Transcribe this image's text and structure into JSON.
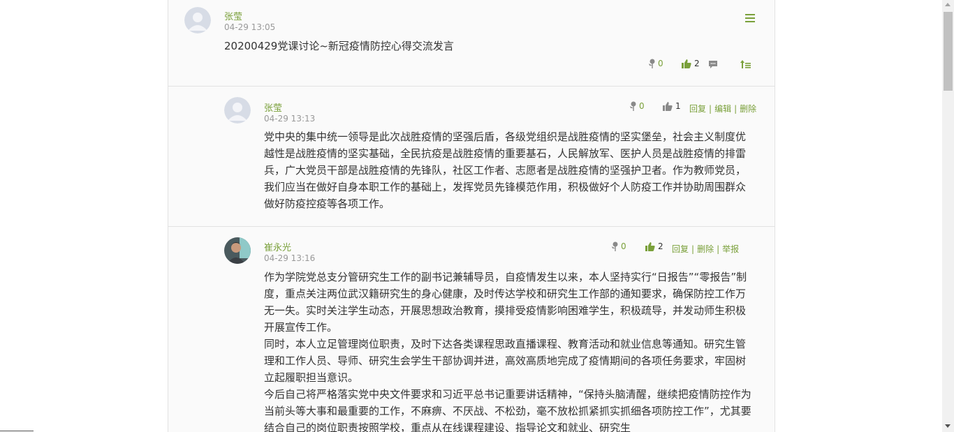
{
  "post": {
    "author": "张莹",
    "time": "04-29 13:05",
    "title": "20200429党课讨论~新冠疫情防控心得交流发言",
    "flower_count": "0",
    "like_count": "2",
    "icons": [
      "menu-icon",
      "flower-icon",
      "thumbs-up-icon",
      "comment-icon",
      "sort-icon"
    ]
  },
  "replies": [
    {
      "author": "张莹",
      "time": "04-29 13:13",
      "flower_count": "0",
      "like_count": "1",
      "actions": [
        "回复",
        "编辑",
        "删除"
      ],
      "paragraphs": [
        "党中央的集中统一领导是此次战胜疫情的坚强后盾，各级党组织是战胜疫情的坚实堡垒，社会主义制度优越性是战胜疫情的坚实基础，全民抗疫是战胜疫情的重要基石，人民解放军、医护人员是战胜疫情的排雷兵，广大党员干部是战胜疫情的先锋队，社区工作者、志愿者是战胜疫情的坚强护卫者。作为教师党员，我们应当在做好自身本职工作的基础上，发挥党员先锋模范作用，积极做好个人防疫工作并协助周围群众做好防疫控疫等各项工作。"
      ]
    },
    {
      "author": "崔永光",
      "time": "04-29 13:16",
      "flower_count": "0",
      "like_count": "2",
      "actions": [
        "回复",
        "删除",
        "举报"
      ],
      "paragraphs": [
        "作为学院党总支分管研究生工作的副书记兼辅导员，自疫情发生以来，本人坚持实行“日报告”“零报告”制度，重点关注两位武汉籍研究生的身心健康，及时传达学校和研究生工作部的通知要求，确保防控工作万无一失。实时关注学生动态，开展思想政治教育，摸排受疫情影响困难学生，积极疏导，并发动师生积极开展宣传工作。",
        "同时，本人立足管理岗位职责，及时下达各类课程思政直播课程、教育活动和就业信息等通知。研究生管理和工作人员、导师、研究生会学生干部协调并进，高效高质地完成了疫情期间的各项任务要求，牢固树立起履职担当意识。",
        "今后自己将严格落实党中央文件要求和习近平总书记重要讲话精神，“保持头脑清醒，继续把疫情防控作为当前头等大事和最重要的工作，不麻痹、不厌战、不松劲，毫不放松抓紧抓实抓细各项防控工作”，尤其要结合自己的岗位职责按照学校，重点从在线课程建设、指导论文和就业、研究生"
      ]
    }
  ],
  "colors": {
    "accent": "#7aa03a",
    "text": "#333333",
    "muted": "#999999",
    "border": "#e2e2e2",
    "panel_bg": "#fafafa"
  }
}
